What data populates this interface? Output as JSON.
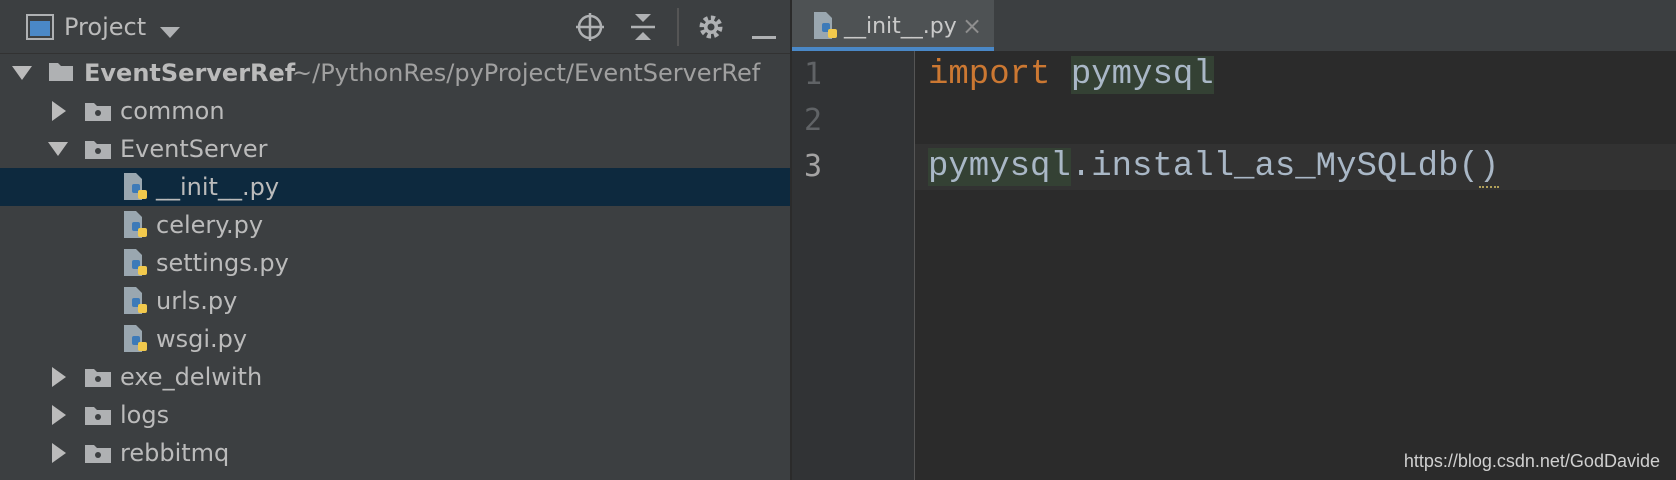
{
  "project_panel": {
    "title": "Project",
    "header_icons": [
      "project-view-icon",
      "dropdown-arrow-icon",
      "locate-icon",
      "collapse-all-icon",
      "gear-icon",
      "minimize-icon"
    ],
    "tree": {
      "root": {
        "name": "EventServerRef",
        "path": "~/PythonRes/pyProject/EventServerRef",
        "expanded": true
      },
      "items": [
        {
          "label": "common",
          "type": "folder",
          "expanded": false
        },
        {
          "label": "EventServer",
          "type": "folder",
          "expanded": true
        },
        {
          "label": "__init__.py",
          "type": "python-file",
          "selected": true
        },
        {
          "label": "celery.py",
          "type": "python-file"
        },
        {
          "label": "settings.py",
          "type": "python-file"
        },
        {
          "label": "urls.py",
          "type": "python-file"
        },
        {
          "label": "wsgi.py",
          "type": "python-file"
        },
        {
          "label": "exe_delwith",
          "type": "folder",
          "expanded": false
        },
        {
          "label": "logs",
          "type": "folder",
          "expanded": false
        },
        {
          "label": "rebbitmq",
          "type": "folder",
          "expanded": false
        }
      ]
    }
  },
  "editor": {
    "tab": {
      "label": "__init__.py",
      "close": "×"
    },
    "line_numbers": [
      "1",
      "2",
      "3"
    ],
    "code": {
      "line1": {
        "keyword": "import",
        "module": "pymysql"
      },
      "line3": {
        "module": "pymysql",
        "call": ".install_as_MySQLdb",
        "open_paren": "(",
        "close_paren": ")"
      }
    }
  },
  "watermark": "https://blog.csdn.net/GodDavide",
  "colors": {
    "panel_bg": "#3c3f41",
    "editor_bg": "#2b2b2b",
    "selection": "#0d293e",
    "keyword": "#cc7832",
    "code_text": "#a9b7c6",
    "tab_underline": "#4a88c7"
  }
}
